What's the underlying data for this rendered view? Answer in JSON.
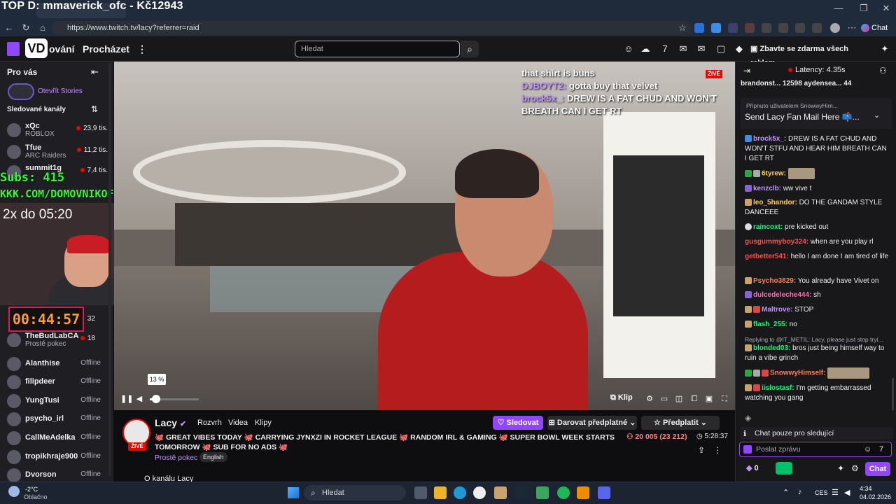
{
  "browser": {
    "url": "https://www.twitch.tv/lacy?referrer=raid",
    "chat_label": "Chat",
    "overlay_title": "TOP D: mmaverick_ofc - Kč12943"
  },
  "topnav": {
    "logo_text": "VD",
    "following_suffix": "ování",
    "browse": "Procházet",
    "search_placeholder": "Hledat",
    "ad_free": "Zbavte se zdarma všech reklam"
  },
  "sidebar": {
    "title": "Pro vás",
    "stories": "Otevřít Stories",
    "followed": "Sledované kanály",
    "channels": [
      {
        "name": "xQc",
        "sub": "ROBLOX",
        "viewers": "23,9 tis."
      },
      {
        "name": "Tfue",
        "sub": "ARC Raiders",
        "viewers": "11,2 tis."
      },
      {
        "name": "summit1g",
        "sub": "",
        "viewers": "7,4 tis."
      },
      {
        "name": "",
        "sub": "",
        "viewers": "32"
      },
      {
        "name": "TheBudLabCA",
        "sub": "Prostě pokec",
        "viewers": "18"
      },
      {
        "name": "Alanthise",
        "sub": "",
        "viewers": "Offline"
      },
      {
        "name": "filipdeer",
        "sub": "",
        "viewers": "Offline"
      },
      {
        "name": "YungTusi",
        "sub": "",
        "viewers": "Offline"
      },
      {
        "name": "psycho_irl",
        "sub": "",
        "viewers": "Offline"
      },
      {
        "name": "CallMeAdelka",
        "sub": "",
        "viewers": "Offline"
      },
      {
        "name": "tropikhraje900",
        "sub": "",
        "viewers": "Offline"
      },
      {
        "name": "Dvorson",
        "sub": "",
        "viewers": "Offline"
      }
    ]
  },
  "stream_overlay": {
    "subs": "Subs: 415",
    "link": "KKK.COM/DOMOVNIKOFC",
    "multiplier": "2x do 05:20",
    "timer": "00:44:57"
  },
  "video": {
    "live_badge": "ŽIVĚ",
    "overlay_chat": [
      {
        "user": "",
        "text": "that shirt is buns"
      },
      {
        "user": "DJBOYT2:",
        "text": "gotta buy that velvet"
      },
      {
        "user": "brock5x_:",
        "text": "DREW IS A FAT CHUD AND WON'T BREATH CAN I GET RT"
      }
    ],
    "volume_percent": 13,
    "volume_label": "13 %",
    "clip_label": "Klip"
  },
  "channel": {
    "name": "Lacy",
    "live": "ŽIVĚ",
    "tabs": [
      "Rozvrh",
      "Videa",
      "Klipy"
    ],
    "title": "🐙 GREAT VIBES TODAY 🐙 CARRYING JYNXZI IN ROCKET LEAGUE 🐙 RANDOM IRL & GAMING 🐙 SUPER BOWL WEEK STARTS TOMORROW 🐙 SUB FOR NO ADS 🐙",
    "category": "Prostě pokec",
    "language": "English",
    "follow": "Sledovat",
    "gift": "Darovat předplatné",
    "subscribe": "Předplatit",
    "viewers": "20 005 (23 212)",
    "uptime": "5:28:37",
    "about": "O kanálu Lacy"
  },
  "chat": {
    "latency": "Latency: 4.35s",
    "gift_row": "brandonst...  12598   aydensea...  44",
    "pinned_by": "Připnuto uživatelem SnowwyHim...",
    "pinned_msg": "Send Lacy Fan Mail Here 📫...",
    "messages": [
      {
        "user": "brock5x_:",
        "color": "#bf94ff",
        "text": "DREW IS A FAT CHUD AND WON'T STFU AND HEAR HIM BREATH CAN I GET RT"
      },
      {
        "user": "6tyrew:",
        "color": "#ffd23f",
        "text": ""
      },
      {
        "user": "kenzclb:",
        "color": "#bf94ff",
        "text": "ww vive t"
      },
      {
        "user": "leo_5handor:",
        "color": "#ffd23f",
        "text": "DO THE GANDAM STYLE DANCEEE"
      },
      {
        "user": "raincoxt:",
        "color": "#00ff7f",
        "text": "pre kicked out"
      },
      {
        "user": "gusgummyboy324:",
        "color": "#ff4d4d",
        "text": "when are you play rl"
      },
      {
        "user": "getbetter541:",
        "color": "#ff4d4d",
        "text": "hello I am done I am tired of life"
      },
      {
        "user": "Psycho3829:",
        "color": "#ff7f50",
        "text": "You already have Vivet on"
      },
      {
        "user": "dulcedeleche444:",
        "color": "#ff69b4",
        "text": "sh"
      },
      {
        "user": "Maltrove:",
        "color": "#bf94ff",
        "text": "STOP"
      },
      {
        "user": "flash_255:",
        "color": "#00ff7f",
        "text": "no"
      },
      {
        "user": "blonded03:",
        "color": "#00ff7f",
        "text": "bros just being himself way to ruin a vibe grinch"
      },
      {
        "user": "SnowwyHimself:",
        "color": "#ff7f50",
        "text": ""
      },
      {
        "user": "iislostasf:",
        "color": "#00ff7f",
        "text": "I'm getting embarrassed watching you gang"
      }
    ],
    "reply_to": "Replying to @IT_METIL: Lacy, please just stop tryi...",
    "followers_only": "Chat pouze pro sledující",
    "input_placeholder": "Poslat zprávu",
    "points": "0",
    "send": "Chat"
  },
  "taskbar": {
    "temp": "-2°C",
    "weather": "Oblačno",
    "search": "Hledat",
    "lang": "CES",
    "time": "4:34",
    "date": "04.02.2026"
  }
}
